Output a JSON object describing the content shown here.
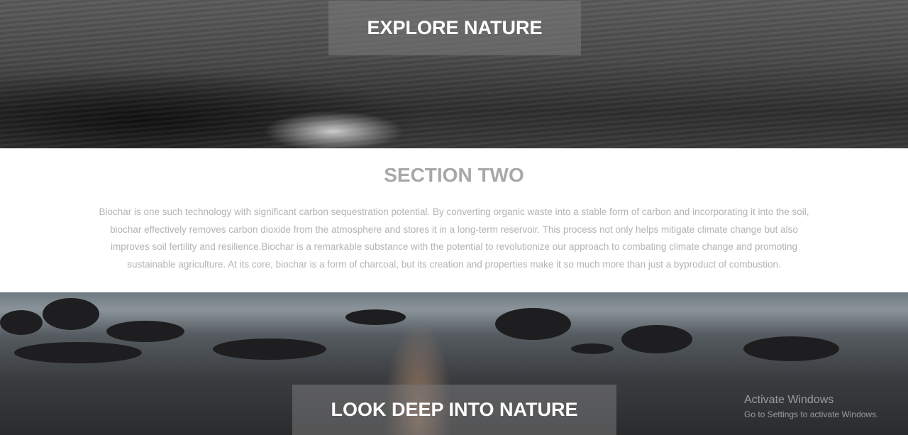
{
  "hero_top": {
    "title": "EXPLORE NATURE"
  },
  "section_two": {
    "title": "SECTION TWO",
    "body": "Biochar is one such technology with significant carbon sequestration potential. By converting organic waste into a stable form of carbon and incorporating it into the soil, biochar effectively removes carbon dioxide from the atmosphere and stores it in a long-term reservoir. This process not only helps mitigate climate change but also improves soil fertility and resilience.Biochar is a remarkable substance with the potential to revolutionize our approach to combating climate change and promoting sustainable agriculture. At its core, biochar is a form of charcoal, but its creation and properties make it so much more than just a byproduct of combustion."
  },
  "hero_bottom": {
    "title": "LOOK DEEP INTO NATURE"
  },
  "windows_watermark": {
    "line1": "Activate Windows",
    "line2": "Go to Settings to activate Windows."
  }
}
